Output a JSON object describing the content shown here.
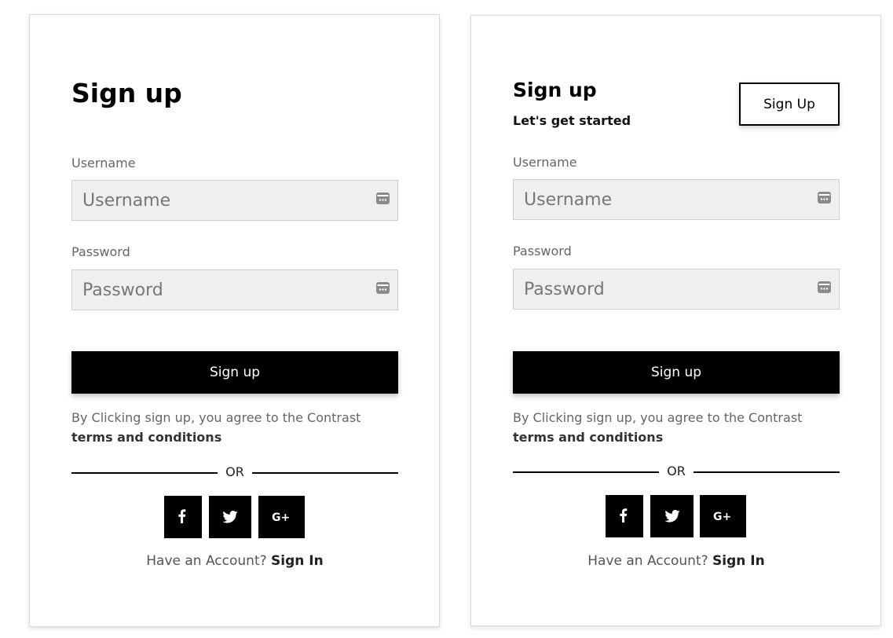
{
  "cards": [
    {
      "title": "Sign up",
      "username_label": "Username",
      "username_placeholder": "Username",
      "password_label": "Password",
      "password_placeholder": "Password",
      "submit_label": "Sign up",
      "agree_text": "By Clicking sign up, you agree to the Contrast",
      "terms_link": "terms and conditions",
      "divider_text": "OR",
      "have_account_text": "Have an Account?",
      "signin_link": "Sign In",
      "social": [
        "facebook",
        "twitter",
        "google-plus"
      ]
    },
    {
      "title": "Sign up",
      "subtitle": "Let's get started",
      "header_button": "Sign Up",
      "username_label": "Username",
      "username_placeholder": "Username",
      "password_label": "Password",
      "password_placeholder": "Password",
      "submit_label": "Sign up",
      "agree_text": "By Clicking sign up, you agree to the Contrast",
      "terms_link": "terms and conditions",
      "divider_text": "OR",
      "have_account_text": "Have an Account?",
      "signin_link": "Sign In",
      "social": [
        "facebook",
        "twitter",
        "google-plus"
      ]
    }
  ],
  "colors": {
    "primary": "#000000",
    "field_bg": "#efefef",
    "muted_text": "#666666"
  },
  "icons": {
    "field_icon": "password-manager-icon",
    "social": [
      "facebook-icon",
      "twitter-icon",
      "google-plus-icon"
    ]
  }
}
